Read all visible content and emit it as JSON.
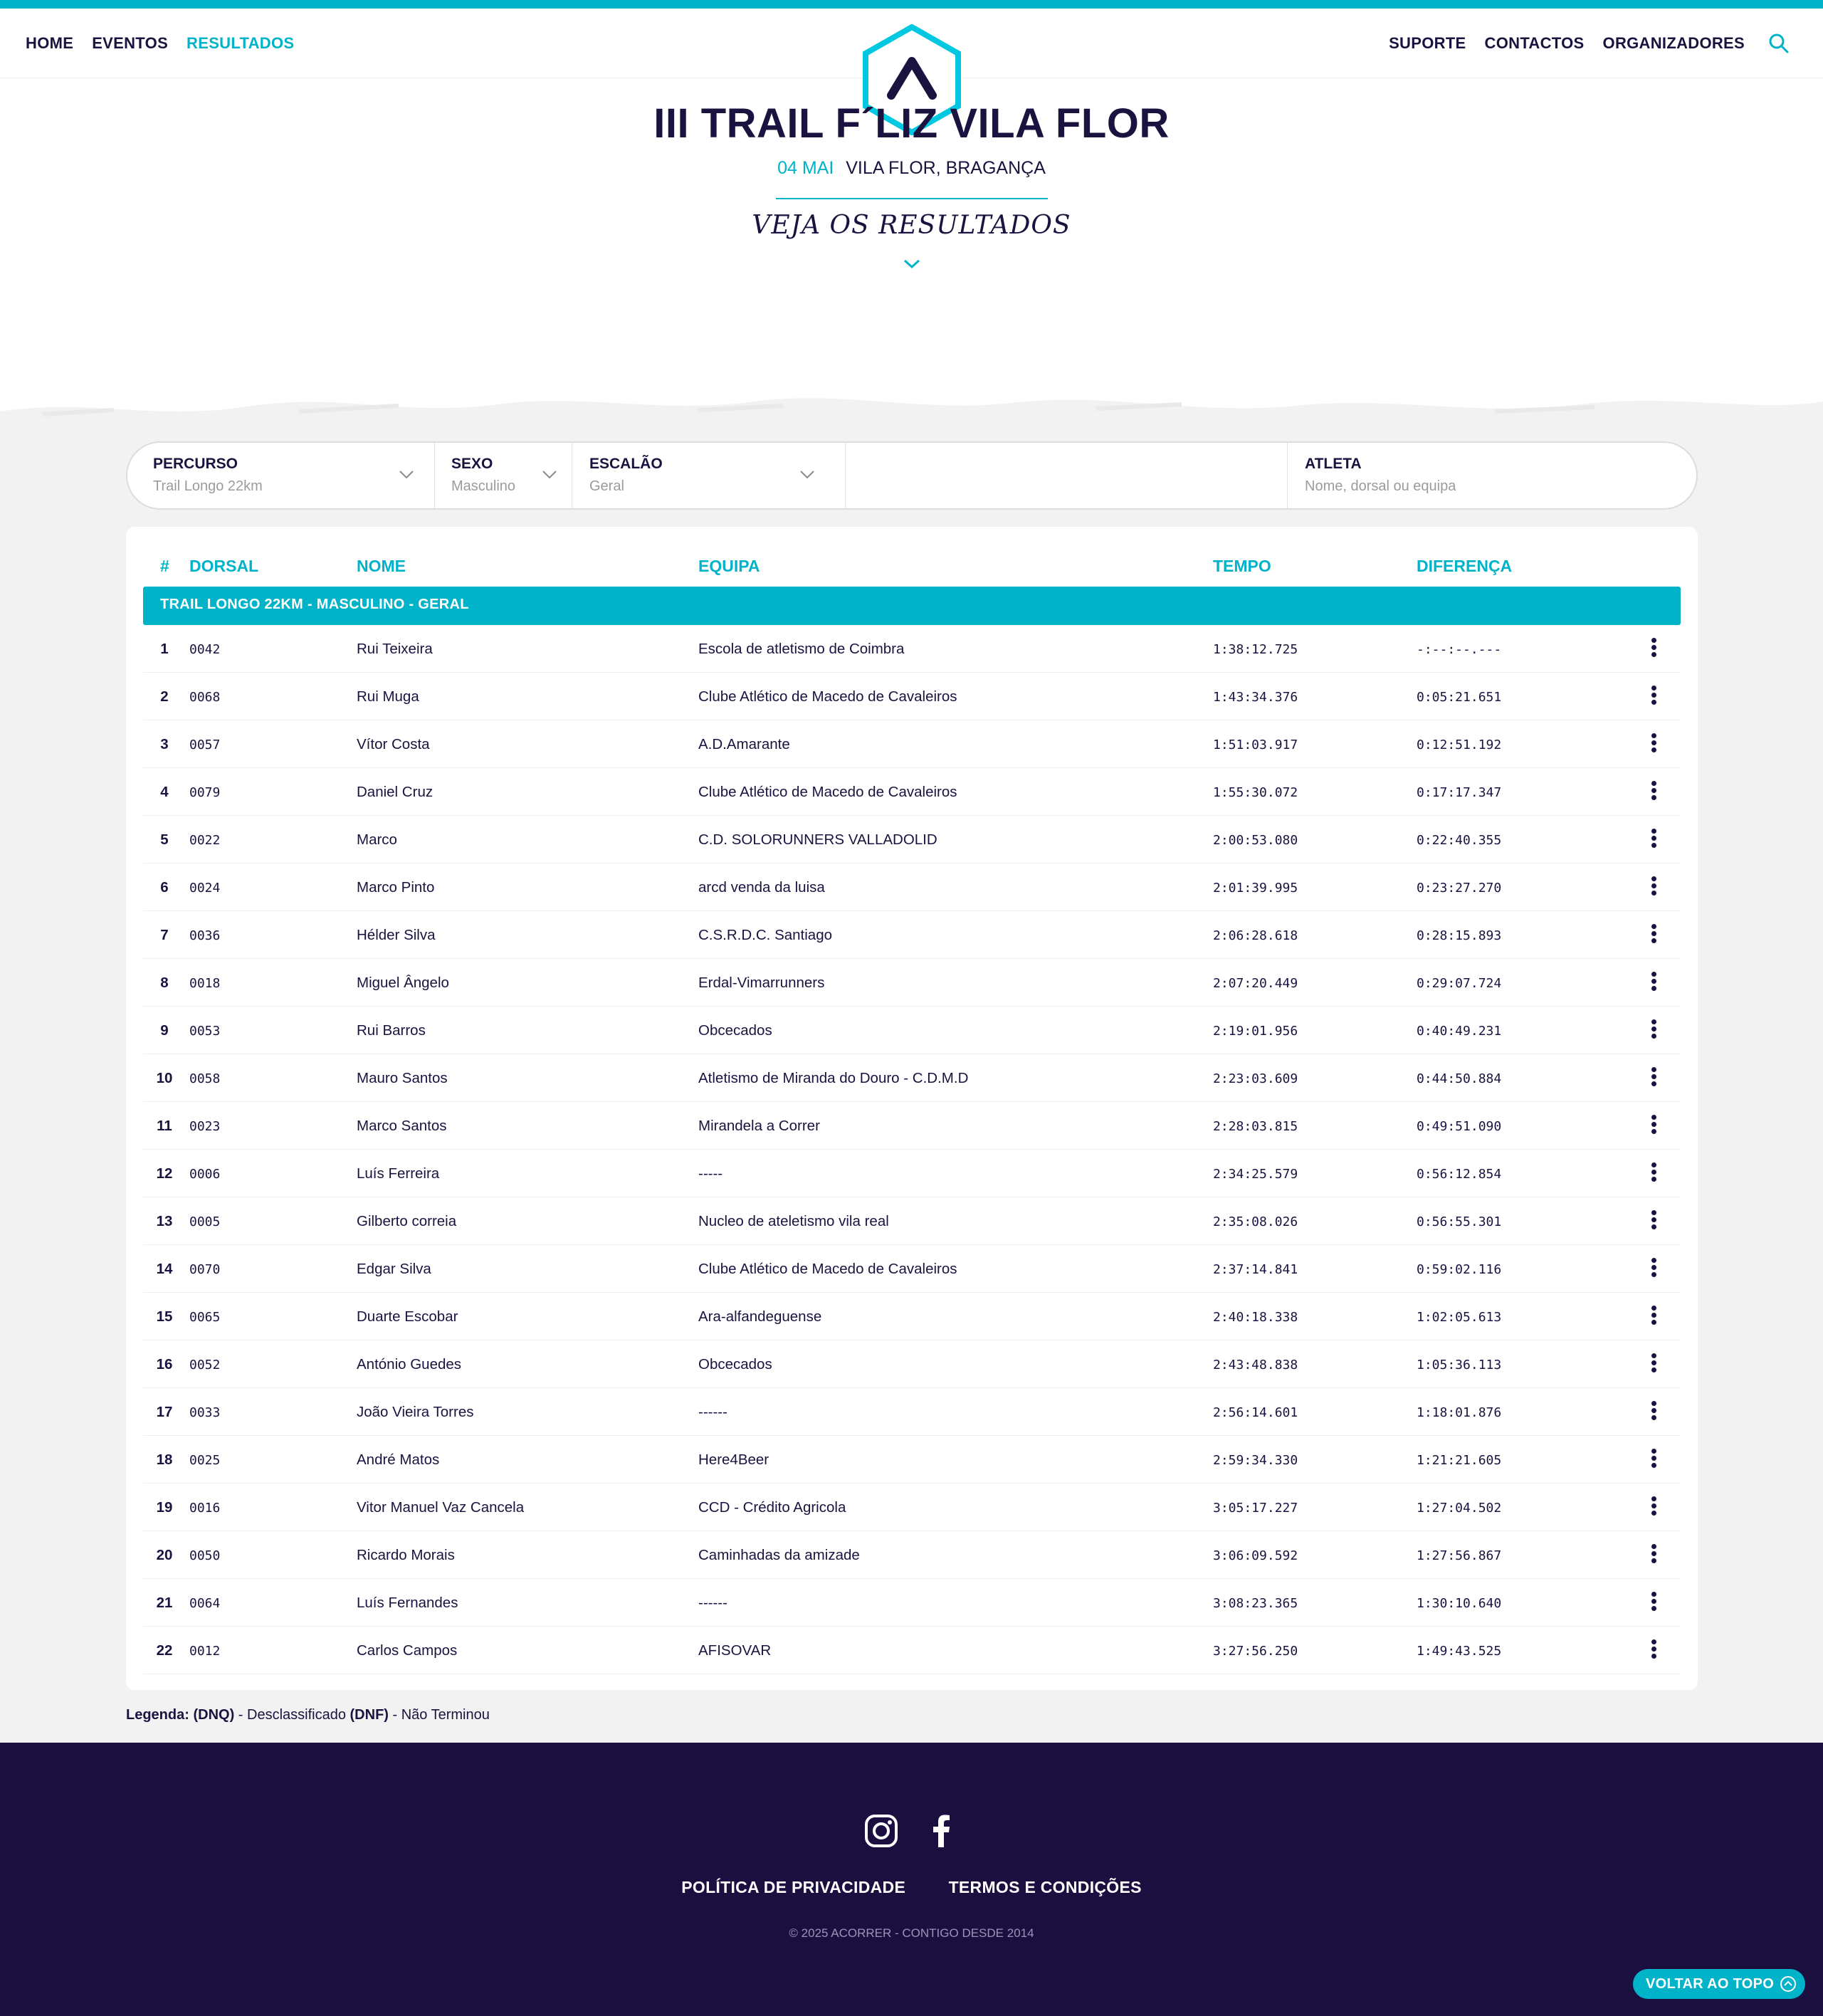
{
  "nav": {
    "left": [
      "HOME",
      "EVENTOS",
      "RESULTADOS"
    ],
    "active": "RESULTADOS",
    "right": [
      "SUPORTE",
      "CONTACTOS",
      "ORGANIZADORES"
    ]
  },
  "colors": {
    "accent": "#00b3c9",
    "navy": "#1c1240",
    "footer": "#1b0f40"
  },
  "event": {
    "title": "III TRAIL F´LIZ VILA FLOR",
    "date": "04 MAI",
    "location": "VILA FLOR, BRAGANÇA",
    "cta": "VEJA OS RESULTADOS"
  },
  "filters": {
    "percurso": {
      "label": "PERCURSO",
      "value": "Trail Longo 22km"
    },
    "sexo": {
      "label": "SEXO",
      "value": "Masculino"
    },
    "escalao": {
      "label": "ESCALÃO",
      "value": "Geral"
    },
    "atleta": {
      "label": "ATLETA",
      "placeholder": "Nome, dorsal ou equipa"
    }
  },
  "table": {
    "headers": [
      "#",
      "DORSAL",
      "NOME",
      "EQUIPA",
      "TEMPO",
      "DIFERENÇA"
    ],
    "group": "TRAIL LONGO 22KM - MASCULINO - GERAL",
    "rows": [
      {
        "pos": "1",
        "dorsal": "0042",
        "nome": "Rui Teixeira",
        "equipa": "Escola de atletismo de Coimbra",
        "tempo": "1:38:12.725",
        "dif": "-:--:--.---"
      },
      {
        "pos": "2",
        "dorsal": "0068",
        "nome": "Rui Muga",
        "equipa": "Clube Atlético de Macedo de Cavaleiros",
        "tempo": "1:43:34.376",
        "dif": "0:05:21.651"
      },
      {
        "pos": "3",
        "dorsal": "0057",
        "nome": "Vítor Costa",
        "equipa": "A.D.Amarante",
        "tempo": "1:51:03.917",
        "dif": "0:12:51.192"
      },
      {
        "pos": "4",
        "dorsal": "0079",
        "nome": "Daniel Cruz",
        "equipa": "Clube Atlético de Macedo de Cavaleiros",
        "tempo": "1:55:30.072",
        "dif": "0:17:17.347"
      },
      {
        "pos": "5",
        "dorsal": "0022",
        "nome": "Marco",
        "equipa": "C.D. SOLORUNNERS VALLADOLID",
        "tempo": "2:00:53.080",
        "dif": "0:22:40.355"
      },
      {
        "pos": "6",
        "dorsal": "0024",
        "nome": "Marco Pinto",
        "equipa": "arcd venda da luisa",
        "tempo": "2:01:39.995",
        "dif": "0:23:27.270"
      },
      {
        "pos": "7",
        "dorsal": "0036",
        "nome": "Hélder Silva",
        "equipa": "C.S.R.D.C. Santiago",
        "tempo": "2:06:28.618",
        "dif": "0:28:15.893"
      },
      {
        "pos": "8",
        "dorsal": "0018",
        "nome": "Miguel Ângelo",
        "equipa": "Erdal-Vimarrunners",
        "tempo": "2:07:20.449",
        "dif": "0:29:07.724"
      },
      {
        "pos": "9",
        "dorsal": "0053",
        "nome": "Rui Barros",
        "equipa": "Obcecados",
        "tempo": "2:19:01.956",
        "dif": "0:40:49.231"
      },
      {
        "pos": "10",
        "dorsal": "0058",
        "nome": "Mauro Santos",
        "equipa": "Atletismo de Miranda do Douro - C.D.M.D",
        "tempo": "2:23:03.609",
        "dif": "0:44:50.884"
      },
      {
        "pos": "11",
        "dorsal": "0023",
        "nome": "Marco Santos",
        "equipa": "Mirandela a Correr",
        "tempo": "2:28:03.815",
        "dif": "0:49:51.090"
      },
      {
        "pos": "12",
        "dorsal": "0006",
        "nome": "Luís Ferreira",
        "equipa": "-----",
        "tempo": "2:34:25.579",
        "dif": "0:56:12.854"
      },
      {
        "pos": "13",
        "dorsal": "0005",
        "nome": "Gilberto correia",
        "equipa": "Nucleo de ateletismo vila real",
        "tempo": "2:35:08.026",
        "dif": "0:56:55.301"
      },
      {
        "pos": "14",
        "dorsal": "0070",
        "nome": "Edgar Silva",
        "equipa": "Clube Atlético de Macedo de Cavaleiros",
        "tempo": "2:37:14.841",
        "dif": "0:59:02.116"
      },
      {
        "pos": "15",
        "dorsal": "0065",
        "nome": "Duarte Escobar",
        "equipa": "Ara-alfandeguense",
        "tempo": "2:40:18.338",
        "dif": "1:02:05.613"
      },
      {
        "pos": "16",
        "dorsal": "0052",
        "nome": "António Guedes",
        "equipa": "Obcecados",
        "tempo": "2:43:48.838",
        "dif": "1:05:36.113"
      },
      {
        "pos": "17",
        "dorsal": "0033",
        "nome": "João Vieira Torres",
        "equipa": "------",
        "tempo": "2:56:14.601",
        "dif": "1:18:01.876"
      },
      {
        "pos": "18",
        "dorsal": "0025",
        "nome": "André Matos",
        "equipa": "Here4Beer",
        "tempo": "2:59:34.330",
        "dif": "1:21:21.605"
      },
      {
        "pos": "19",
        "dorsal": "0016",
        "nome": "Vitor Manuel Vaz Cancela",
        "equipa": "CCD - Crédito Agricola",
        "tempo": "3:05:17.227",
        "dif": "1:27:04.502"
      },
      {
        "pos": "20",
        "dorsal": "0050",
        "nome": "Ricardo Morais",
        "equipa": "Caminhadas da amizade",
        "tempo": "3:06:09.592",
        "dif": "1:27:56.867"
      },
      {
        "pos": "21",
        "dorsal": "0064",
        "nome": "Luís Fernandes",
        "equipa": "------",
        "tempo": "3:08:23.365",
        "dif": "1:30:10.640"
      },
      {
        "pos": "22",
        "dorsal": "0012",
        "nome": "Carlos Campos",
        "equipa": "AFISOVAR",
        "tempo": "3:27:56.250",
        "dif": "1:49:43.525"
      }
    ]
  },
  "legend": {
    "title": "Legenda:",
    "dnq_code": "(DNQ)",
    "dnq_text": " - Desclassificado ",
    "dnf_code": "(DNF)",
    "dnf_text": " - Não Terminou"
  },
  "footer": {
    "links": [
      "POLÍTICA DE PRIVACIDADE",
      "TERMOS E CONDIÇÕES"
    ],
    "copyright": "© 2025 ACORRER - CONTIGO DESDE 2014",
    "back_to_top": "VOLTAR AO TOPO"
  },
  "icons": [
    "search-icon",
    "logo",
    "chevron-down-icon",
    "more-vertical-icon",
    "instagram-icon",
    "facebook-icon",
    "arrow-up-circle-icon"
  ]
}
